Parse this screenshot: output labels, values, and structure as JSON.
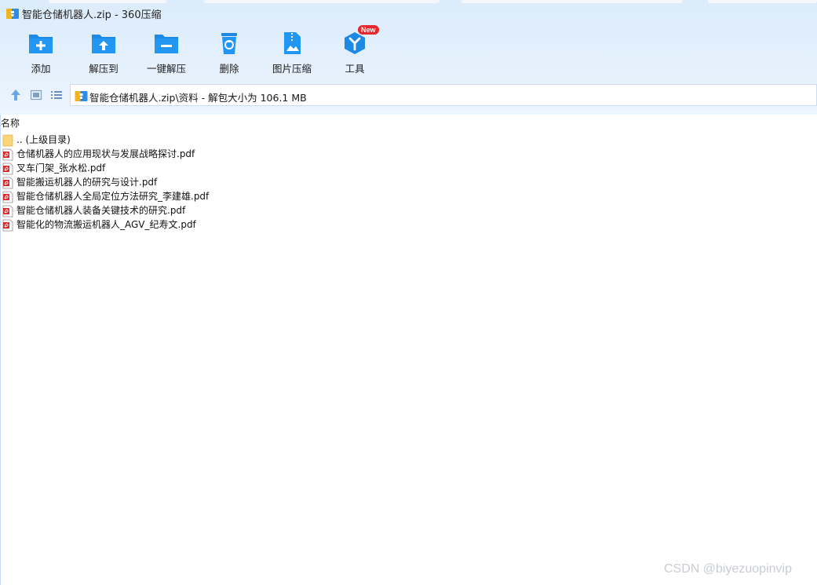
{
  "window": {
    "title": "智能仓储机器人.zip - 360压缩"
  },
  "toolbar": {
    "items": [
      {
        "label": "添加",
        "icon": "add-folder-icon"
      },
      {
        "label": "解压到",
        "icon": "extract-to-icon"
      },
      {
        "label": "一键解压",
        "icon": "one-click-extract-icon"
      },
      {
        "label": "删除",
        "icon": "trash-icon"
      },
      {
        "label": "图片压缩",
        "icon": "image-compress-icon"
      },
      {
        "label": "工具",
        "icon": "tools-hex-icon",
        "badge": "New"
      }
    ],
    "accent_color": "#1e90e8",
    "badge_color": "#e8262e"
  },
  "address": {
    "path": "智能仓储机器人.zip\\资料 - 解包大小为 106.1 MB"
  },
  "list": {
    "column_name": "名称",
    "items": [
      {
        "name": ".. (上级目录)",
        "type": "folder-up"
      },
      {
        "name": "仓储机器人的应用现状与发展战略探讨.pdf",
        "type": "pdf"
      },
      {
        "name": "叉车门架_张水松.pdf",
        "type": "pdf"
      },
      {
        "name": "智能搬运机器人的研究与设计.pdf",
        "type": "pdf"
      },
      {
        "name": "智能仓储机器人全局定位方法研究_李建雄.pdf",
        "type": "pdf"
      },
      {
        "name": "智能仓储机器人装备关键技术的研究.pdf",
        "type": "pdf"
      },
      {
        "name": "智能化的物流搬运机器人_AGV_纪寿文.pdf",
        "type": "pdf"
      }
    ]
  },
  "watermark": "CSDN @biyezuopinvip"
}
